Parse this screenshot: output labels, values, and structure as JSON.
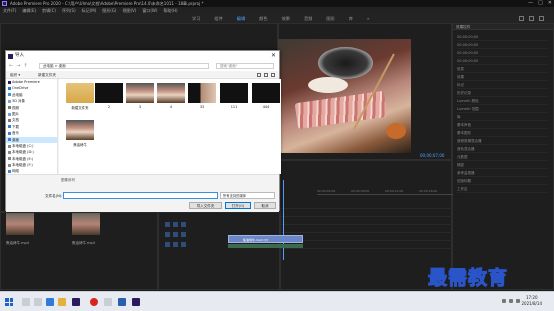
{
  "window": {
    "title": "Adobe Premiere Pro 2020 - C:\\用户\\Ulmo\\文档\\Adobe\\Premiere Pro\\14.0\\未命名1011 - 18章.prproj *",
    "controls": [
      "—",
      "□",
      "✕"
    ]
  },
  "menu": [
    "文件(F)",
    "编辑(E)",
    "剪辑(C)",
    "序列(S)",
    "标记(M)",
    "图形(G)",
    "视图(V)",
    "窗口(W)",
    "帮助(H)"
  ],
  "workspaces": {
    "tabs": [
      "学习",
      "组件",
      "编辑",
      "颜色",
      "效果",
      "音频",
      "图形",
      "库",
      "»"
    ],
    "active_index": 2
  },
  "program_monitor": {
    "timecode": "00;00;07;00"
  },
  "timeline": {
    "ruler": [
      "00;00;04;00",
      "00;00;08;00",
      "00;00;12;00",
      "00;00;16;00"
    ],
    "clip_label": "焦油烤牛.mp4 [V]"
  },
  "right_panel": {
    "header": "效果控件",
    "rows": [
      "00;00;00;00",
      "00;00;00;00",
      "00;00;00;00",
      "00;00;00;00",
      "信息",
      "效果",
      "标记",
      "历史记录",
      "Lumetri 颜色",
      "Lumetri 范围",
      "库",
      "基本声音",
      "基本图形",
      "音频剪辑混合器",
      "音轨混合器",
      "元数据",
      "捕捉",
      "参考监视器",
      "旧版标题",
      "工作区"
    ]
  },
  "project_panel": {
    "items": [
      "焦油烤牛.mp4",
      "焦油烤牛.mp4"
    ]
  },
  "dialog": {
    "title": "导入",
    "close": "✕",
    "nav_arrows": [
      "←",
      "→",
      "↑",
      "⟳"
    ],
    "address": "此电脑 > 桌面",
    "search_placeholder": "搜索\"桌面\"",
    "organize": "组织 ▾",
    "new_folder": "新建文件夹",
    "nav_items": [
      {
        "label": "Adobe Premiere",
        "color": "#2b1a5e"
      },
      {
        "label": "OneDrive",
        "color": "#1e78d7"
      },
      {
        "label": "此电脑",
        "color": "#4a90d9"
      },
      {
        "label": "3D 对象",
        "color": "#7aa7d8"
      },
      {
        "label": "视频",
        "color": "#7a7a7a"
      },
      {
        "label": "图片",
        "color": "#6fa3d8"
      },
      {
        "label": "文档",
        "color": "#7a7a7a"
      },
      {
        "label": "下载",
        "color": "#2f7fd6"
      },
      {
        "label": "音乐",
        "color": "#3d7fd3"
      },
      {
        "label": "桌面",
        "color": "#3f82d6"
      },
      {
        "label": "本地磁盘 (C:)",
        "color": "#8a8a8a"
      },
      {
        "label": "本地磁盘 (D:)",
        "color": "#8a8a8a"
      },
      {
        "label": "本地磁盘 (E:)",
        "color": "#8a8a8a"
      },
      {
        "label": "本地磁盘 (F:)",
        "color": "#8a8a8a"
      },
      {
        "label": "网络",
        "color": "#3f82d6"
      }
    ],
    "nav_selected_index": 9,
    "files": [
      {
        "name": "新建文件夹",
        "kind": "folder"
      },
      {
        "name": "2",
        "kind": "dark"
      },
      {
        "name": "3",
        "kind": "food"
      },
      {
        "name": "4",
        "kind": "food"
      },
      {
        "name": "33",
        "kind": "mix"
      },
      {
        "name": "111",
        "kind": "dark"
      },
      {
        "name": "444",
        "kind": "dark"
      },
      {
        "name": "焦油烤牛",
        "kind": "food"
      }
    ],
    "sequence_label": "图像序列",
    "filename_label": "文件名(N):",
    "filename_value": "",
    "filetype": "所有支持的媒体",
    "buttons": {
      "import_folder": "导入文件夹",
      "open": "打开(O)",
      "cancel": "取消"
    }
  },
  "taskbar": {
    "time": "17:20",
    "date": "2021/8/14"
  },
  "watermark": "最需教育"
}
